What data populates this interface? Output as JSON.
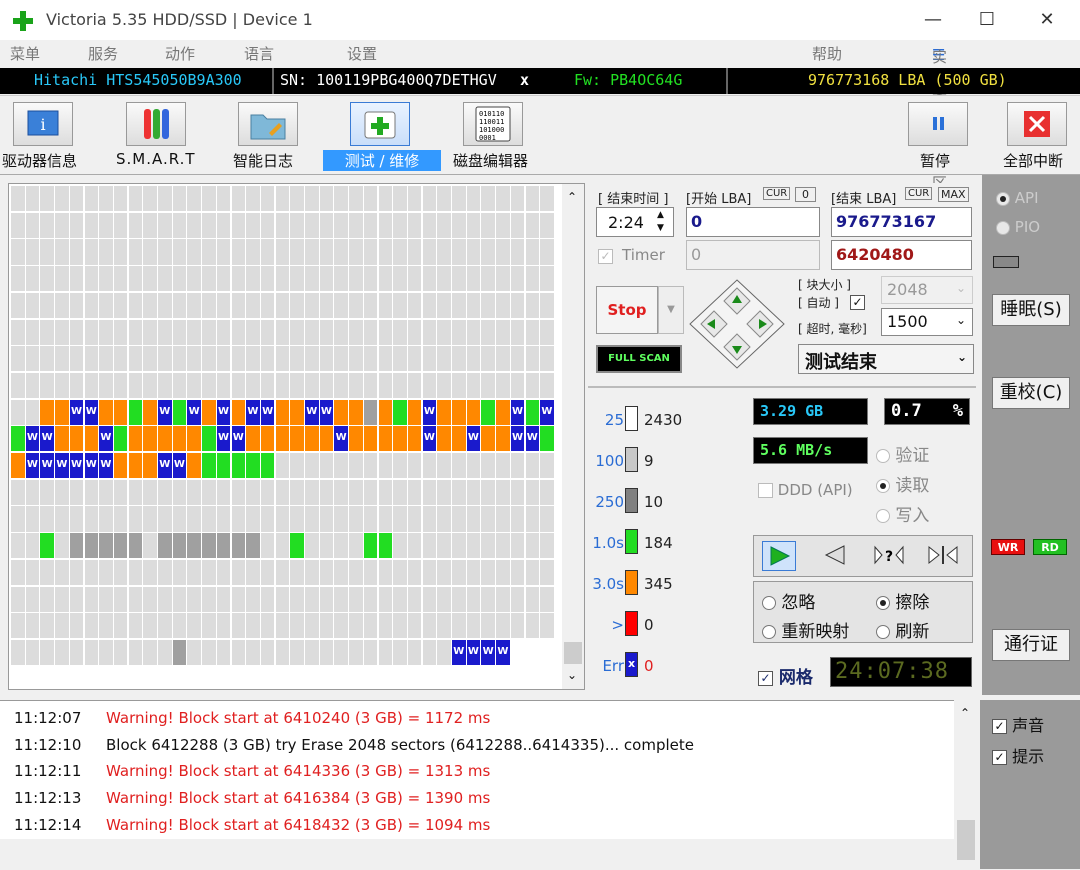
{
  "window": {
    "title": "Victoria 5.35 HDD/SSD | Device 1",
    "minimize": "—",
    "maximize": "☐",
    "close": "✕"
  },
  "menu": {
    "items": [
      "菜单",
      "服务",
      "动作",
      "语言",
      "设置"
    ],
    "help": "帮助",
    "buffer": "实时查看缓冲区"
  },
  "info": {
    "model": "Hitachi HTS545050B9A300",
    "serial": "SN: 100119PBG400Q7DETHGV",
    "close_x": "x",
    "firmware": "Fw: PB4OC64G",
    "lba": "976773168 LBA (500 GB)"
  },
  "toolbar": {
    "drive_info": "驱动器信息",
    "smart": "S.M.A.R.T",
    "log": "智能日志",
    "test": "测试 / 维修",
    "disk_editor": "磁盘编辑器",
    "pause": "暂停",
    "abort": "全部中断",
    "editor_icon_text": "010110\n110011\n101000\n0001"
  },
  "test": {
    "end_time_label": "[ 结束时间 ]",
    "start_lba_label": "[开始 LBA]",
    "cur": "CUR",
    "zero": "0",
    "end_lba_label": "[结束 LBA]",
    "max": "MAX",
    "time": "2:24",
    "start_lba": "0",
    "end_lba": "976773167",
    "timer_label": "Timer",
    "timer_value": "0",
    "current_lba": "6420480",
    "stop": "Stop",
    "block_size_label": "[ 块大小 ]",
    "auto_label": "[ 自动 ]",
    "timeout_label": "[ 超时, 毫秒]",
    "block_size": "2048",
    "timeout": "1500",
    "full_scan": "FULL SCAN",
    "status": "测试结束"
  },
  "latency": [
    {
      "label": "25",
      "count": "2430",
      "color": "#ffffff"
    },
    {
      "label": "100",
      "count": "9",
      "color": "#c8c8c8"
    },
    {
      "label": "250",
      "count": "10",
      "color": "#808080"
    },
    {
      "label": "1.0s",
      "count": "184",
      "color": "#22dd22"
    },
    {
      "label": "3.0s",
      "count": "345",
      "color": "#ff8800"
    },
    {
      "label": ">",
      "count": "0",
      "color": "#ff0000"
    },
    {
      "label": "Err",
      "count": "0",
      "color": "#1a1acc"
    }
  ],
  "stats": {
    "size": "3.29 GB",
    "percent_value": "0.7",
    "percent_sign": "%",
    "speed": "5.6 MB/s",
    "verify": "验证",
    "read": "读取",
    "write": "写入",
    "ddd": "DDD (API)"
  },
  "actions": {
    "ignore": "忽略",
    "erase": "擦除",
    "remap": "重新映射",
    "refresh": "刷新",
    "grid_label": "网格",
    "clock": "24:07:38"
  },
  "side": {
    "api": "API",
    "pio": "PIO",
    "sleep": "睡眠(S)",
    "recal": "重校(C)",
    "wr": "WR",
    "rd": "RD",
    "passport": "通行证",
    "sound": "声音",
    "hints": "提示"
  },
  "log": [
    {
      "time": "11:12:07",
      "msg": "Warning! Block start at 6410240 (3 GB)  = 1172 ms",
      "warn": true
    },
    {
      "time": "11:12:10",
      "msg": "Block 6412288 (3 GB) try Erase 2048 sectors (6412288..6414335)... complete",
      "warn": false
    },
    {
      "time": "11:12:11",
      "msg": "Warning! Block start at 6414336 (3 GB)  = 1313 ms",
      "warn": true
    },
    {
      "time": "11:12:13",
      "msg": "Warning! Block start at 6416384 (3 GB)  = 1390 ms",
      "warn": true
    },
    {
      "time": "11:12:14",
      "msg": "Warning! Block start at 6418432 (3 GB)  = 1094 ms",
      "warn": true
    }
  ],
  "map": {
    "cols": 37,
    "rows": [
      "",
      "",
      "",
      "",
      "",
      "",
      "",
      "",
      "..OOWWOOGOWGWOWOWWOOWWOOgOGOWOOOGOWGW",
      "GWWOOOWGOOOOOGWWOOOOOOWOOOOOWOOWOOWWGW",
      "OWWWWWWOOOWWOGGGGG...................",
      "",
      "",
      "..G.ggggg.ggggggg..G....GG...........",
      "",
      "",
      "",
      "...........g..................WWWW",
      "WOWOWWWWWWOOOWOWOOOOOWOOOOOWOOOOO"
    ]
  }
}
